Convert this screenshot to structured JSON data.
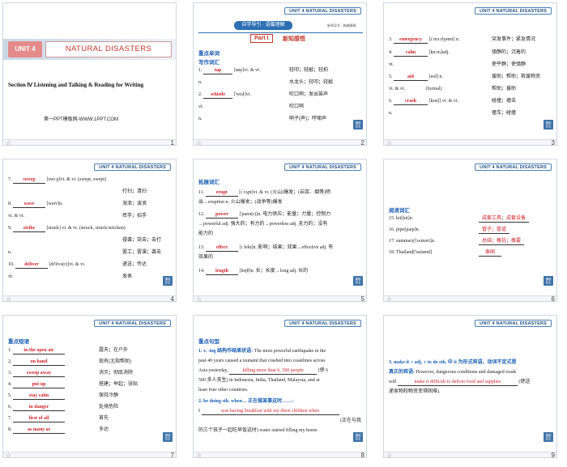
{
  "header_tag": "UNIT 4  NATURAL DISASTERS",
  "nav_button": "课前\n自主",
  "slides": [
    {
      "number": "1",
      "unit_badge": "UNIT 4",
      "unit_title": "NATURAL DISASTERS",
      "section": "Section Ⅳ  Listening and Talking & Reading for Writing",
      "template_credit": "第一PPT模板网-WWW.1PPT.COM"
    },
    {
      "number": "2",
      "tab_label": "自学导引 · 语篇理解",
      "part_label": "Part Ⅰ",
      "part_title": "新知感悟",
      "sub_tab": "新知导学 · 跨越障碍",
      "sec1": "重点单词",
      "sec2": "写作词汇",
      "rows": [
        {
          "n": "1.",
          "ans": "tap",
          "pron": "[tæp]vi. & vt.",
          "cn": "轻叩；轻敲；轻拍"
        },
        {
          "n": "n.",
          "ans": "",
          "pron": "",
          "cn": "水龙头；轻叩；轻敲"
        },
        {
          "n": "2.",
          "ans": "whistle",
          "pron": "['wɪsl]vi.",
          "cn": "吹口哨；发出笛声"
        },
        {
          "n": "vt.",
          "ans": "",
          "pron": "",
          "cn": "吹口哨"
        },
        {
          "n": "n.",
          "ans": "",
          "pron": "",
          "cn": "哨子(声)；呼啸声"
        }
      ]
    },
    {
      "number": "3",
      "rows": [
        {
          "n": "3.",
          "ans": "emergency",
          "pron": "[iˈmɜːdʒənsi] n.",
          "cn": "突发事件；紧急情况"
        },
        {
          "n": "4.",
          "ans": "calm",
          "pron": "[kɑːm]adj.",
          "cn": "镇静的；沉着的"
        },
        {
          "n": "vt.",
          "ans": "",
          "pron": "",
          "cn": "使平静；使镇静"
        },
        {
          "n": "5.",
          "ans": "aid",
          "pron": "[eɪd] n.",
          "cn": "援助；帮助；救援物资"
        },
        {
          "n": "vi. & vt.",
          "ans": "",
          "pron": "(formal)",
          "cn": "帮助；援助"
        },
        {
          "n": "6.",
          "ans": "crash",
          "pron": "[kræʃ] vi. & vt.",
          "cn": "碰撞；撞击"
        },
        {
          "n": "n.",
          "ans": "",
          "pron": "",
          "cn": "撞车；碰撞"
        }
      ]
    },
    {
      "number": "4",
      "rows": [
        {
          "n": "7.",
          "ans": "sweep",
          "pron": "[swiːp]vt. & vi. (swept, swept)",
          "cn": ""
        },
        {
          "n": "",
          "ans": "",
          "pron": "",
          "cn": "打扫；清扫"
        },
        {
          "n": "8.",
          "ans": "wave",
          "pron": "[weɪv]n.",
          "cn": "海浪；波浪"
        },
        {
          "n": "vi. & vt.",
          "ans": "",
          "pron": "",
          "cn": "挥手；招手"
        },
        {
          "n": "9.",
          "ans": "strike",
          "pron": "[straɪk] vi. & vt. (struck, struck/stricken)",
          "cn": ""
        },
        {
          "n": "",
          "ans": "",
          "pron": "",
          "cn": "侵袭；突击；击打"
        },
        {
          "n": "n.",
          "ans": "",
          "pron": "",
          "cn": "罢工；罢课；袭击"
        },
        {
          "n": "10.",
          "ans": "deliver",
          "pron": "[dɪ'lɪvə(r)]vt. & vi.",
          "cn": "递送；传达"
        },
        {
          "n": "vt.",
          "ans": "",
          "pron": "",
          "cn": "发表"
        }
      ]
    },
    {
      "number": "5",
      "sec": "拓展词汇",
      "rows": [
        {
          "n": "11.",
          "ans": "erupt",
          "text": "[ɪˈrʌpt]vi. & vt. (火山)爆发；(岩浆、烟等)喷",
          "text2": "出→eruption n. 火山爆发；(战争等)爆发"
        },
        {
          "n": "12.",
          "ans": "power",
          "text": "['paʊə(r)]n. 电力供应；能量；力量；控制力",
          "text2": "→powerful adj. 强大的；有力的→powerless adj. 无力的；没有",
          "text3": "能力的"
        },
        {
          "n": "13.",
          "ans": "effect",
          "text": "[ɪˈfekt]n. 影响；结果；效果→effective adj. 有",
          "text2": "效果的"
        },
        {
          "n": "14.",
          "ans": "length",
          "text": "[leŋθ]n. 长；长度→long adj. 长的"
        }
      ]
    },
    {
      "number": "6",
      "sec": "阅读词汇",
      "rows": [
        {
          "n": "15.",
          "word": "kit[kɪt]n.",
          "cn": "成套工具；成套设备"
        },
        {
          "n": "16.",
          "word": "pipe[paɪp]n.",
          "cn": "管子；管道"
        },
        {
          "n": "17.",
          "word": "summary['sʌməri]n.",
          "cn": "总结；概括；概要"
        },
        {
          "n": "18.",
          "word": "Thailand['taɪlænd]",
          "cn": "泰国"
        }
      ]
    },
    {
      "number": "7",
      "sec": "重点短语",
      "rows": [
        {
          "n": "1.",
          "ans": "in the open air",
          "cn": "露天；在户外"
        },
        {
          "n": "2.",
          "ans": "on hand",
          "cn": "现有(尤指帮助)"
        },
        {
          "n": "3.",
          "ans": "sweep away",
          "cn": "消灭；彻底消除"
        },
        {
          "n": "4.",
          "ans": "put up",
          "cn": "搭建；举起；张贴"
        },
        {
          "n": "5.",
          "ans": "stay calm",
          "cn": "保持冷静"
        },
        {
          "n": "6.",
          "ans": "in danger",
          "cn": "处境危险"
        },
        {
          "n": "7.",
          "ans": "first of all",
          "cn": "首先"
        },
        {
          "n": "8.",
          "ans": "as many as",
          "cn": "多达"
        }
      ]
    },
    {
      "number": "8",
      "sec": "重点句型",
      "p1_head": "1. v. -ing 结构作结果状语:",
      "p1_a": "The most powerful earthquake in the",
      "p1_b": "past 40 years caused a tsunami that crashed into coastlines across",
      "p1_c": "Asia yesterday,",
      "p1_ans": "killing more than 6, 500 people",
      "p1_d": "(使 6",
      "p1_e": "500 多人丧生) in Indonesia, India, Thailand, Malaysia, and at",
      "p1_f": "least four other countries.",
      "p2_head": "2. be doing sth. when… 正在做某事这时……:",
      "p2_a": "I",
      "p2_ans": "was having breakfast with my three children when",
      "p2_b": "(正在与我",
      "p2_c": "的三个孩子一起吃早饭这时) water started filling my home."
    },
    {
      "number": "9",
      "l1": "3. make it + adj. + to do sth. 中 it 为形式宾语，动词不定式是",
      "l2": "真正的宾语:",
      "l2b": "However, dangerous conditions and damaged roads",
      "l3a": "will",
      "l3_ans": "make it difficult to deliver food and supplies",
      "l3b": "(使送",
      "l4": "递食物和物资变得困难)."
    }
  ]
}
